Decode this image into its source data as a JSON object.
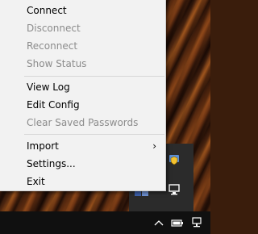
{
  "menu": {
    "items": [
      {
        "label": "Connect",
        "enabled": true
      },
      {
        "label": "Disconnect",
        "enabled": false
      },
      {
        "label": "Reconnect",
        "enabled": false
      },
      {
        "label": "Show Status",
        "enabled": false
      },
      {
        "label": "View Log",
        "enabled": true
      },
      {
        "label": "Edit Config",
        "enabled": true
      },
      {
        "label": "Clear Saved Passwords",
        "enabled": false
      },
      {
        "label": "Import",
        "enabled": true,
        "submenu_arrow": "›"
      },
      {
        "label": "Settings...",
        "enabled": true
      },
      {
        "label": "Exit",
        "enabled": true
      }
    ]
  },
  "tray_flyout": {
    "icons": [
      "vpn-shield-icon",
      "monitor-network-icon",
      "app-icon"
    ]
  },
  "taskbar": {
    "icons": [
      "chevron-up-icon",
      "battery-icon",
      "network-icon"
    ],
    "chevron_glyph": "^"
  }
}
